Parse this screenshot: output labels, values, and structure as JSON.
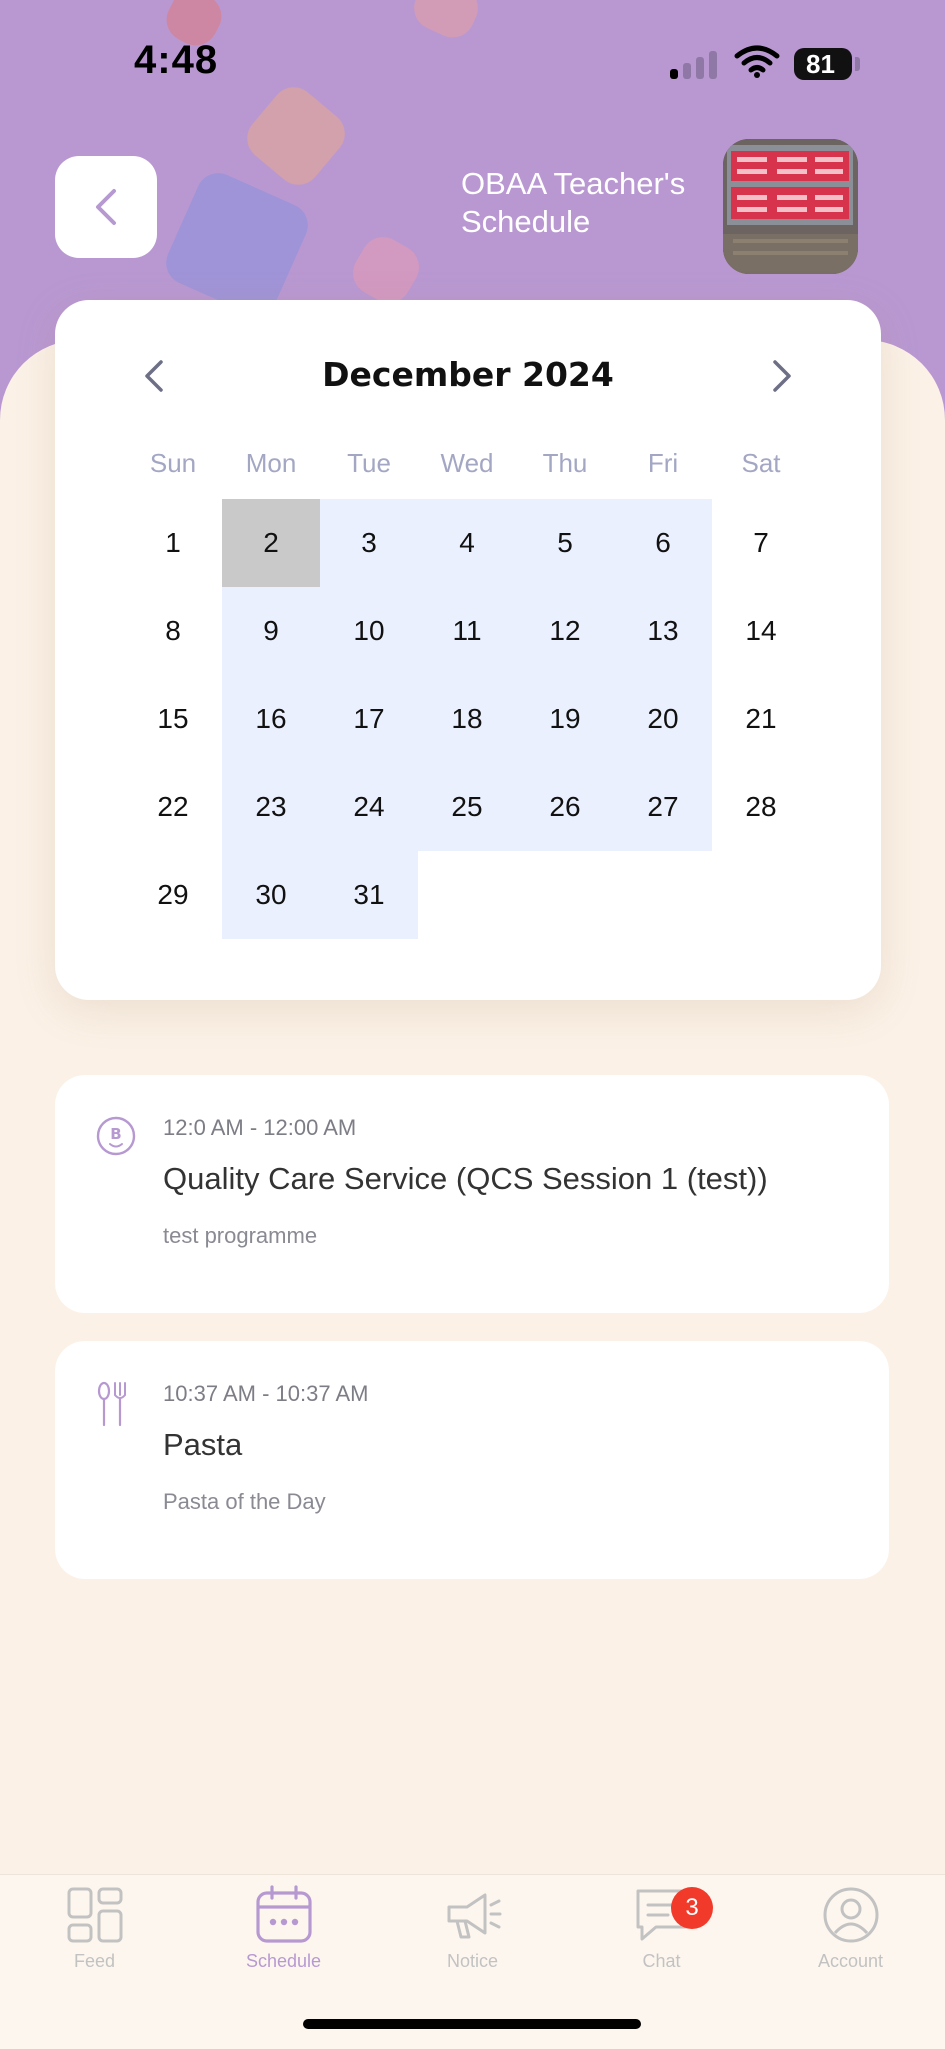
{
  "status_bar": {
    "time": "4:48",
    "battery": "81"
  },
  "header": {
    "title": "OBAA Teacher's Schedule"
  },
  "calendar": {
    "month_label": "December 2024",
    "weekdays": [
      "Sun",
      "Mon",
      "Tue",
      "Wed",
      "Thu",
      "Fri",
      "Sat"
    ],
    "weeks": [
      [
        "1",
        "2",
        "3",
        "4",
        "5",
        "6",
        "7"
      ],
      [
        "8",
        "9",
        "10",
        "11",
        "12",
        "13",
        "14"
      ],
      [
        "15",
        "16",
        "17",
        "18",
        "19",
        "20",
        "21"
      ],
      [
        "22",
        "23",
        "24",
        "25",
        "26",
        "27",
        "28"
      ],
      [
        "29",
        "30",
        "31"
      ]
    ],
    "selected_day": "2"
  },
  "events": [
    {
      "icon": "baby-face-icon",
      "time": "12:0 AM - 12:00 AM",
      "title": "Quality Care Service (QCS Session 1 (test))",
      "description": "test programme"
    },
    {
      "icon": "fork-spoon-icon",
      "time": "10:37 AM - 10:37 AM",
      "title": "Pasta",
      "description": "Pasta of the Day"
    }
  ],
  "tabbar": {
    "items": [
      {
        "label": "Feed",
        "icon": "feed-icon"
      },
      {
        "label": "Schedule",
        "icon": "calendar-icon",
        "active": true
      },
      {
        "label": "Notice",
        "icon": "megaphone-icon"
      },
      {
        "label": "Chat",
        "icon": "chat-icon",
        "badge": "3"
      },
      {
        "label": "Account",
        "icon": "account-icon"
      }
    ]
  },
  "colors": {
    "header_purple": "#b998d2",
    "accent_lavender": "#b799d2",
    "range_highlight": "#ebf0fe",
    "selected_day_bg": "#c9c9c9",
    "badge_red": "#f23a2b"
  }
}
